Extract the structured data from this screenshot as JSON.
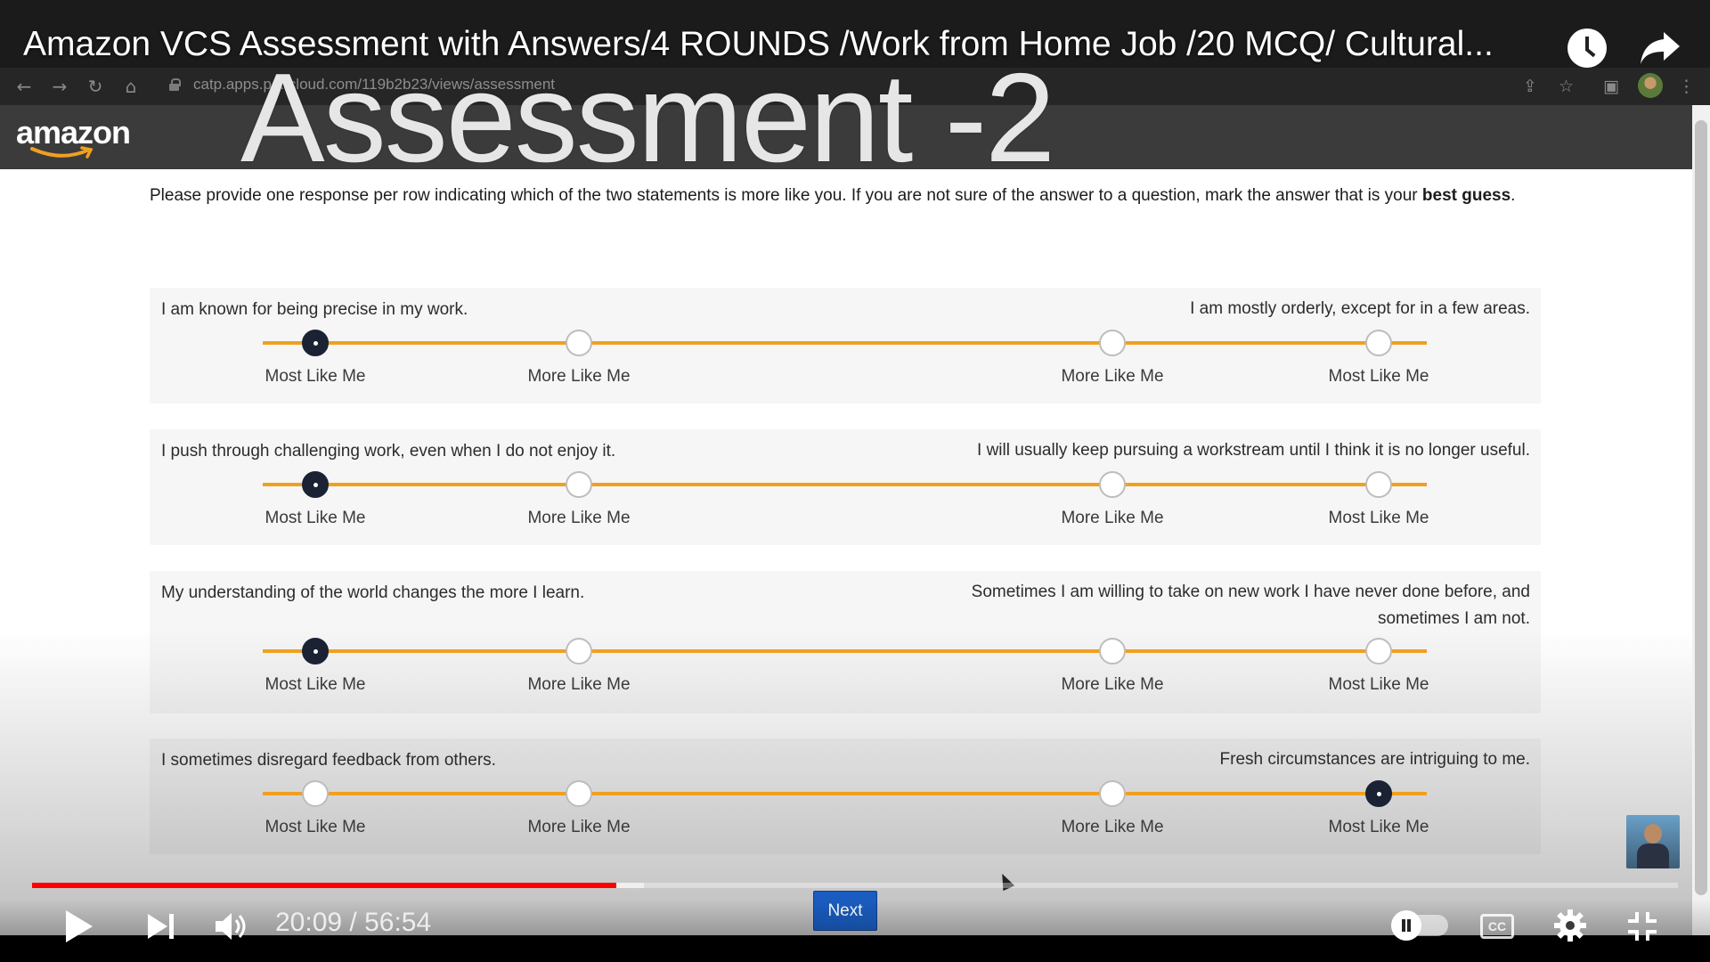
{
  "video": {
    "title": "Amazon VCS Assessment with Answers/4 ROUNDS /Work from Home Job /20 MCQ/ Cultural...",
    "overlay_title": "Assessment -2",
    "time": "20:09 / 56:54",
    "progress_fraction": 0.355,
    "buffer_fraction": 0.372
  },
  "browser": {
    "url": "catp.apps.p... cloud.com/119b2b23/views/assessment"
  },
  "site": {
    "logo": "amazon"
  },
  "assessment": {
    "instruction_prefix": "Please provide one response per row indicating which of the two statements is more like you. If you are not sure of the answer to a question, mark the answer that is your ",
    "instruction_bold": "best guess",
    "instruction_suffix": ".",
    "scale_labels": [
      "Most Like Me",
      "More Like Me",
      "More Like Me",
      "Most Like Me"
    ],
    "rows": [
      {
        "left": "I am known for being precise in my work.",
        "right": "I am mostly orderly, except for in a few areas.",
        "selected": 0
      },
      {
        "left": "I push through challenging work, even when I do not enjoy it.",
        "right": "I will usually keep pursuing a workstream until I think it is no longer useful.",
        "selected": 0
      },
      {
        "left": "My understanding of the world changes the more I learn.",
        "right": "Sometimes I am willing to take on new work I have never done before, and sometimes I am not.",
        "selected": 0
      },
      {
        "left": "I sometimes disregard feedback from others.",
        "right": "Fresh circumstances are intriguing to me.",
        "selected": 3
      }
    ],
    "next_label": "Next"
  },
  "controls": {
    "cc_label": "CC"
  },
  "colors": {
    "track": "#f0a020",
    "selected": "#1a2234",
    "next_button": "#1a5cbf",
    "progress": "#ff0000"
  }
}
